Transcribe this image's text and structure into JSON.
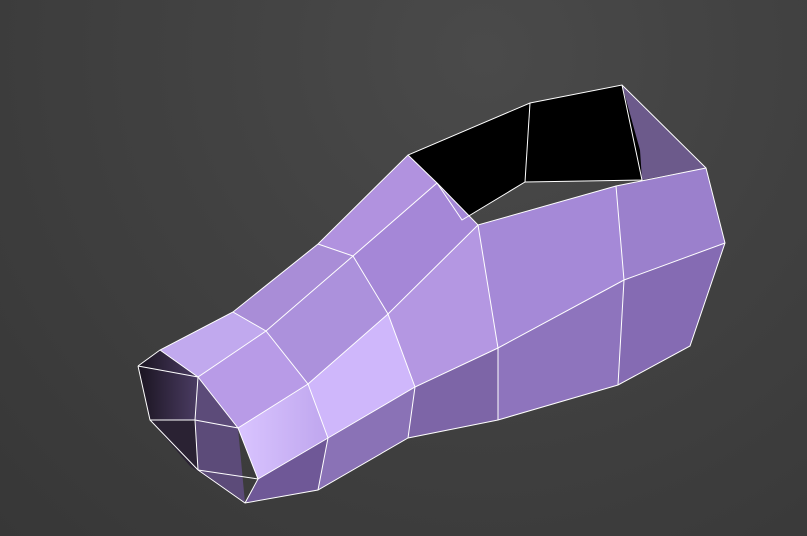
{
  "viewport": {
    "background_color": "#3f3f3f",
    "wire_color": "#ffffff",
    "mesh_base_color": "#a98ad6",
    "mesh_highlight_color": "#d8c2ff",
    "mesh_shadow_color": "#7a62a6",
    "mesh_interior_color": "#000000",
    "object_semantic": "shoe-shaped-low-poly-mesh"
  }
}
